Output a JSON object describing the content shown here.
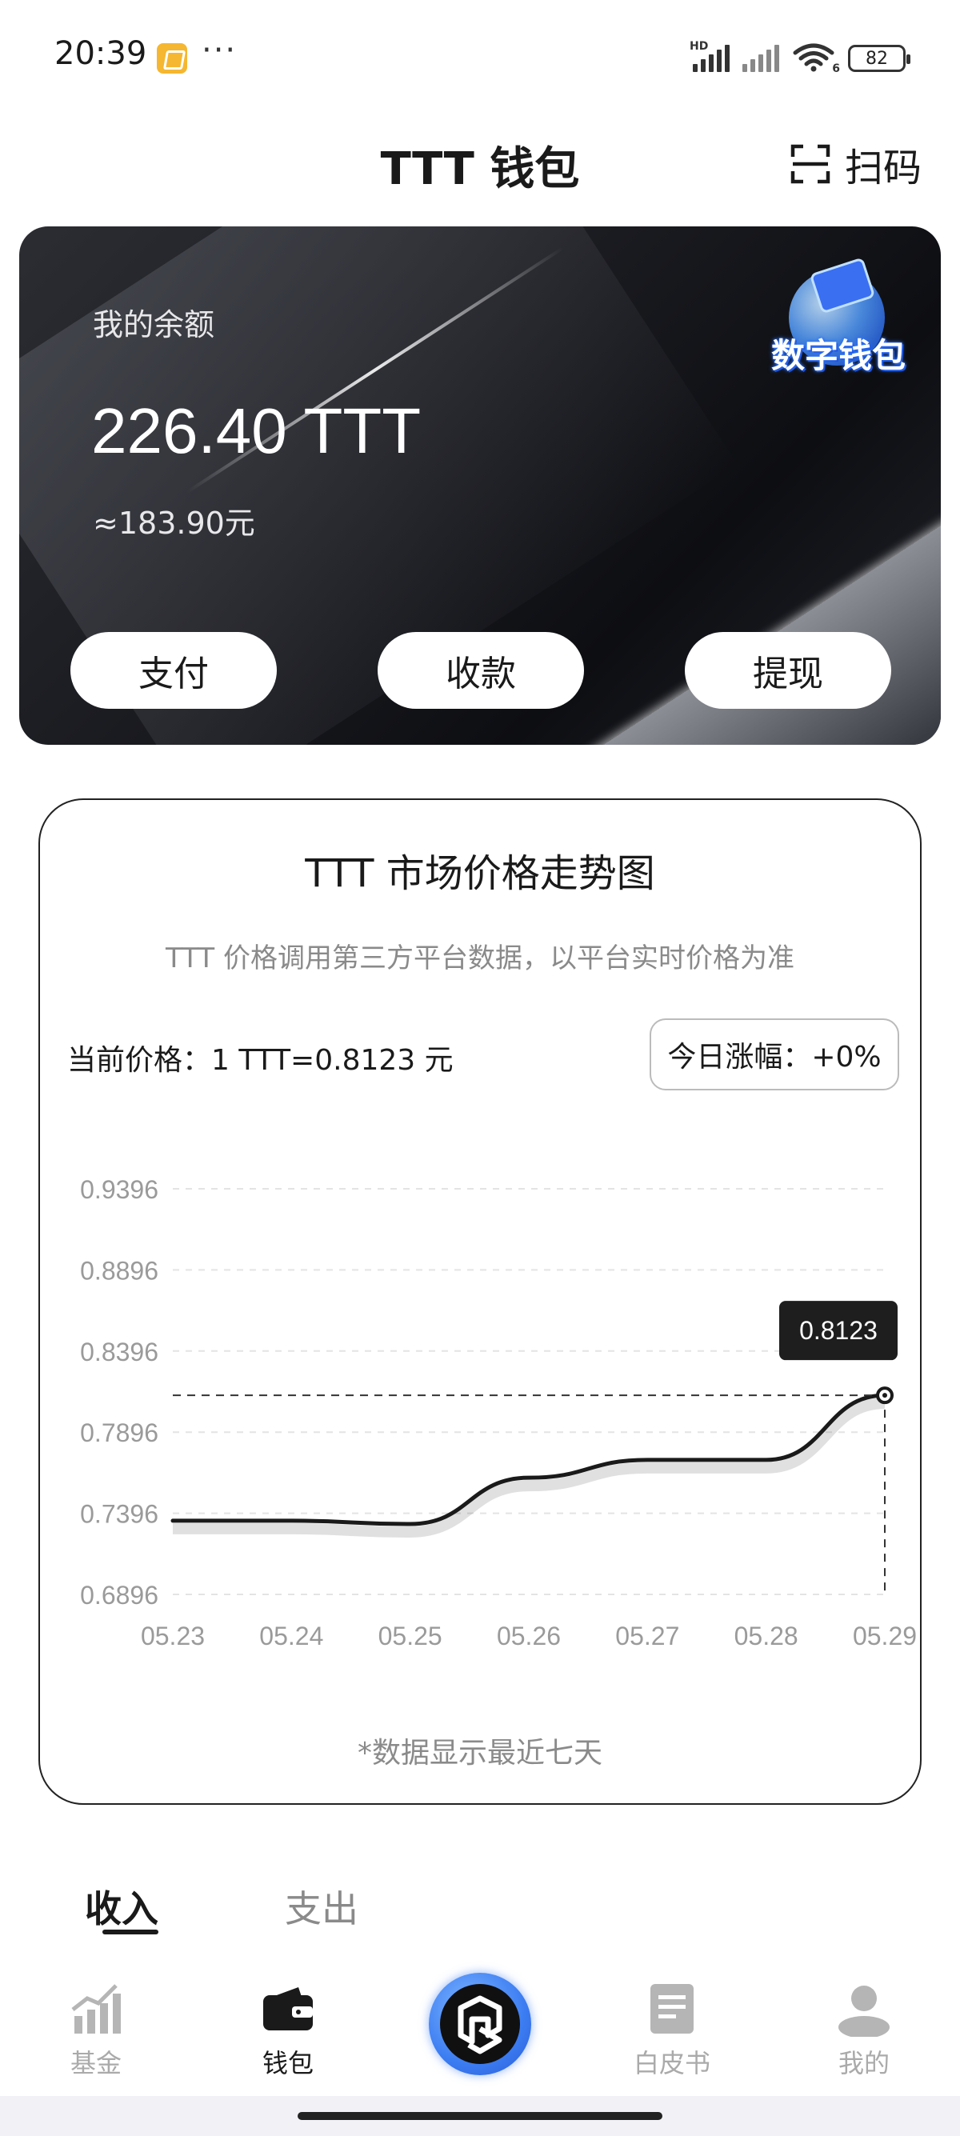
{
  "status_bar": {
    "time": "20:39",
    "more": "···",
    "network_tag": "HD",
    "wifi_tag": "6",
    "battery": "82"
  },
  "header": {
    "title": "TTT 钱包",
    "scan_label": "扫码"
  },
  "balance_card": {
    "label": "我的余额",
    "amount": "226.40 TTT",
    "fiat": "≈183.90元",
    "badge_text": "数字钱包",
    "buttons": {
      "pay": "支付",
      "receive": "收款",
      "withdraw": "提现"
    }
  },
  "price_card": {
    "title": "TTT 市场价格走势图",
    "subtitle": "TTT 价格调用第三方平台数据，以平台实时价格为准",
    "current_price": "当前价格：1 TTT=0.8123 元",
    "today_change": "今日涨幅：+0%",
    "footnote": "*数据显示最近七天"
  },
  "chart_data": {
    "type": "line",
    "x": [
      "05.23",
      "05.24",
      "05.25",
      "05.26",
      "05.27",
      "05.28",
      "05.29"
    ],
    "series": [
      {
        "values": [
          0.735,
          0.735,
          0.733,
          0.7615,
          0.7725,
          0.7725,
          0.8123
        ]
      }
    ],
    "yticks": [
      "0.9396",
      "0.8896",
      "0.8396",
      "0.7896",
      "0.7396",
      "0.6896"
    ],
    "ylim": [
      0.6896,
      0.9396
    ],
    "highlight": {
      "x": "05.29",
      "value": 0.8123,
      "label": "0.8123"
    },
    "grid": true,
    "line_color": "#1a1a1a"
  },
  "tabs": {
    "income": "收入",
    "expense": "支出"
  },
  "bottom_nav": {
    "funds": "基金",
    "wallet": "钱包",
    "whitepaper": "白皮书",
    "mine": "我的"
  }
}
